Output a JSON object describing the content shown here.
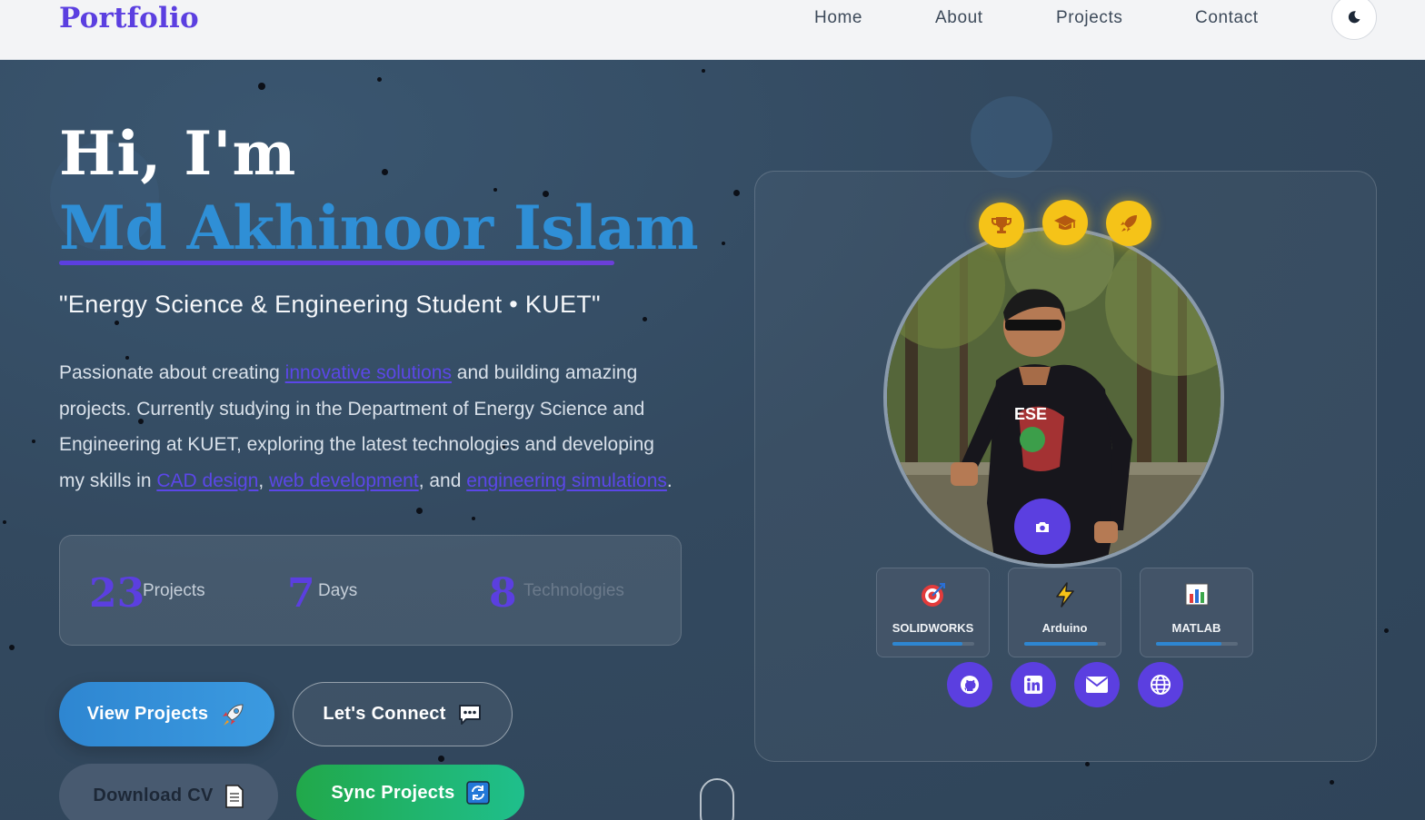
{
  "nav": {
    "brand": "Portfolio",
    "links": [
      "Home",
      "About",
      "Projects",
      "Contact"
    ],
    "theme_icon": "moon-icon"
  },
  "hero": {
    "greeting": "Hi, I'm",
    "name": "Md Akhinoor Islam",
    "subtitle": "\"Energy Science & Engineering Student • KUET\"",
    "bio": {
      "p1": "Passionate about creating ",
      "h1": "innovative solutions",
      "p2": " and building amazing projects. Currently studying in the Department of Energy Science and Engineering at KUET, exploring the latest technologies and developing my skills in ",
      "h2": "CAD design",
      "p3": ", ",
      "h3": "web development",
      "p4": ", and ",
      "h4": "engineering simulations",
      "p5": "."
    },
    "stats": [
      {
        "value": "23",
        "label": "Projects"
      },
      {
        "value": "7",
        "label": "Days"
      },
      {
        "value": "8",
        "label": "Technologies"
      }
    ],
    "buttons": {
      "view_projects": "View Projects",
      "connect": "Let's Connect",
      "download_cv": "Download CV",
      "sync": "Sync Projects"
    }
  },
  "profile": {
    "badges": [
      "trophy-icon",
      "graduation-cap-icon",
      "rocket-icon"
    ],
    "skills": [
      {
        "name": "SOLIDWORKS",
        "icon": "target-icon",
        "level": 0.85
      },
      {
        "name": "Arduino",
        "icon": "lightning-icon",
        "level": 0.9
      },
      {
        "name": "MATLAB",
        "icon": "bar-chart-icon",
        "level": 0.8
      }
    ],
    "socials": [
      "github-icon",
      "linkedin-icon",
      "mail-icon",
      "globe-icon"
    ]
  },
  "colors": {
    "accent": "#5b3fe0",
    "name_blue": "#2f8fd6",
    "badge_yellow": "#f5c318",
    "sync_green": "#21a84a"
  }
}
